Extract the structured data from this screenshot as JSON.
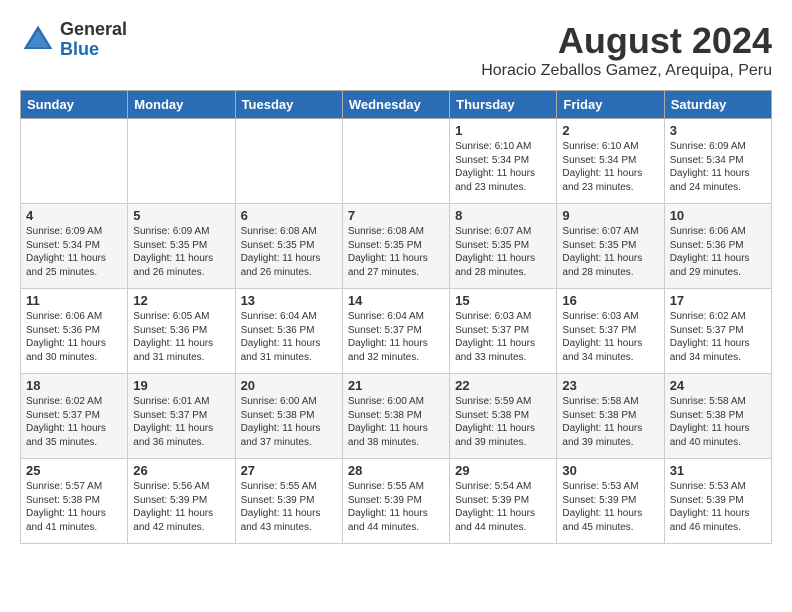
{
  "logo": {
    "general": "General",
    "blue": "Blue"
  },
  "title": "August 2024",
  "subtitle": "Horacio Zeballos Gamez, Arequipa, Peru",
  "headers": [
    "Sunday",
    "Monday",
    "Tuesday",
    "Wednesday",
    "Thursday",
    "Friday",
    "Saturday"
  ],
  "weeks": [
    [
      {
        "day": "",
        "info": ""
      },
      {
        "day": "",
        "info": ""
      },
      {
        "day": "",
        "info": ""
      },
      {
        "day": "",
        "info": ""
      },
      {
        "day": "1",
        "info": "Sunrise: 6:10 AM\nSunset: 5:34 PM\nDaylight: 11 hours\nand 23 minutes."
      },
      {
        "day": "2",
        "info": "Sunrise: 6:10 AM\nSunset: 5:34 PM\nDaylight: 11 hours\nand 23 minutes."
      },
      {
        "day": "3",
        "info": "Sunrise: 6:09 AM\nSunset: 5:34 PM\nDaylight: 11 hours\nand 24 minutes."
      }
    ],
    [
      {
        "day": "4",
        "info": "Sunrise: 6:09 AM\nSunset: 5:34 PM\nDaylight: 11 hours\nand 25 minutes."
      },
      {
        "day": "5",
        "info": "Sunrise: 6:09 AM\nSunset: 5:35 PM\nDaylight: 11 hours\nand 26 minutes."
      },
      {
        "day": "6",
        "info": "Sunrise: 6:08 AM\nSunset: 5:35 PM\nDaylight: 11 hours\nand 26 minutes."
      },
      {
        "day": "7",
        "info": "Sunrise: 6:08 AM\nSunset: 5:35 PM\nDaylight: 11 hours\nand 27 minutes."
      },
      {
        "day": "8",
        "info": "Sunrise: 6:07 AM\nSunset: 5:35 PM\nDaylight: 11 hours\nand 28 minutes."
      },
      {
        "day": "9",
        "info": "Sunrise: 6:07 AM\nSunset: 5:35 PM\nDaylight: 11 hours\nand 28 minutes."
      },
      {
        "day": "10",
        "info": "Sunrise: 6:06 AM\nSunset: 5:36 PM\nDaylight: 11 hours\nand 29 minutes."
      }
    ],
    [
      {
        "day": "11",
        "info": "Sunrise: 6:06 AM\nSunset: 5:36 PM\nDaylight: 11 hours\nand 30 minutes."
      },
      {
        "day": "12",
        "info": "Sunrise: 6:05 AM\nSunset: 5:36 PM\nDaylight: 11 hours\nand 31 minutes."
      },
      {
        "day": "13",
        "info": "Sunrise: 6:04 AM\nSunset: 5:36 PM\nDaylight: 11 hours\nand 31 minutes."
      },
      {
        "day": "14",
        "info": "Sunrise: 6:04 AM\nSunset: 5:37 PM\nDaylight: 11 hours\nand 32 minutes."
      },
      {
        "day": "15",
        "info": "Sunrise: 6:03 AM\nSunset: 5:37 PM\nDaylight: 11 hours\nand 33 minutes."
      },
      {
        "day": "16",
        "info": "Sunrise: 6:03 AM\nSunset: 5:37 PM\nDaylight: 11 hours\nand 34 minutes."
      },
      {
        "day": "17",
        "info": "Sunrise: 6:02 AM\nSunset: 5:37 PM\nDaylight: 11 hours\nand 34 minutes."
      }
    ],
    [
      {
        "day": "18",
        "info": "Sunrise: 6:02 AM\nSunset: 5:37 PM\nDaylight: 11 hours\nand 35 minutes."
      },
      {
        "day": "19",
        "info": "Sunrise: 6:01 AM\nSunset: 5:37 PM\nDaylight: 11 hours\nand 36 minutes."
      },
      {
        "day": "20",
        "info": "Sunrise: 6:00 AM\nSunset: 5:38 PM\nDaylight: 11 hours\nand 37 minutes."
      },
      {
        "day": "21",
        "info": "Sunrise: 6:00 AM\nSunset: 5:38 PM\nDaylight: 11 hours\nand 38 minutes."
      },
      {
        "day": "22",
        "info": "Sunrise: 5:59 AM\nSunset: 5:38 PM\nDaylight: 11 hours\nand 39 minutes."
      },
      {
        "day": "23",
        "info": "Sunrise: 5:58 AM\nSunset: 5:38 PM\nDaylight: 11 hours\nand 39 minutes."
      },
      {
        "day": "24",
        "info": "Sunrise: 5:58 AM\nSunset: 5:38 PM\nDaylight: 11 hours\nand 40 minutes."
      }
    ],
    [
      {
        "day": "25",
        "info": "Sunrise: 5:57 AM\nSunset: 5:38 PM\nDaylight: 11 hours\nand 41 minutes."
      },
      {
        "day": "26",
        "info": "Sunrise: 5:56 AM\nSunset: 5:39 PM\nDaylight: 11 hours\nand 42 minutes."
      },
      {
        "day": "27",
        "info": "Sunrise: 5:55 AM\nSunset: 5:39 PM\nDaylight: 11 hours\nand 43 minutes."
      },
      {
        "day": "28",
        "info": "Sunrise: 5:55 AM\nSunset: 5:39 PM\nDaylight: 11 hours\nand 44 minutes."
      },
      {
        "day": "29",
        "info": "Sunrise: 5:54 AM\nSunset: 5:39 PM\nDaylight: 11 hours\nand 44 minutes."
      },
      {
        "day": "30",
        "info": "Sunrise: 5:53 AM\nSunset: 5:39 PM\nDaylight: 11 hours\nand 45 minutes."
      },
      {
        "day": "31",
        "info": "Sunrise: 5:53 AM\nSunset: 5:39 PM\nDaylight: 11 hours\nand 46 minutes."
      }
    ]
  ]
}
